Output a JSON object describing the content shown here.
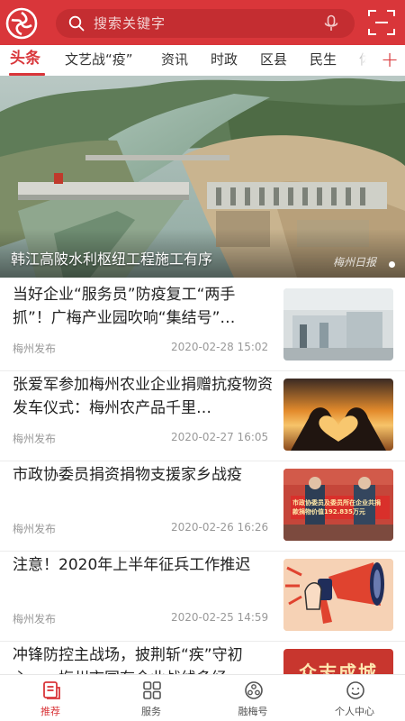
{
  "header": {
    "logo": "meizhou-logo",
    "search_placeholder": "搜索关键字",
    "search_icon": "search-icon",
    "mic_icon": "microphone-icon",
    "scan_icon": "scan-icon",
    "brand_color": "#d9363a"
  },
  "tabs": [
    {
      "label": "头条",
      "active": true
    },
    {
      "label": "文艺战“疫”",
      "active": false
    },
    {
      "label": "资讯",
      "active": false
    },
    {
      "label": "时政",
      "active": false
    },
    {
      "label": "区县",
      "active": false
    },
    {
      "label": "民生",
      "active": false
    },
    {
      "label": "体",
      "active": false
    }
  ],
  "tab_add_label": "+",
  "banner": {
    "title": "韩江高陂水利枢纽工程施工有序",
    "watermark": "梅州日报"
  },
  "news": [
    {
      "title": "当好企业“服务员”防疫复工“两手抓”！广梅产业园吹响“集结号”…",
      "source": "梅州发布",
      "time": "2020-02-28 15:02"
    },
    {
      "title": "张爱军参加梅州农业企业捐赠抗疫物资发车仪式：梅州农产品千里…",
      "source": "梅州发布",
      "time": "2020-02-27 16:05"
    },
    {
      "title": "市政协委员捐资捐物支援家乡战疫",
      "source": "梅州发布",
      "time": "2020-02-26 16:26",
      "banner_text": "市政协委员及委员所在企业共捐款捐物价值192.835万元"
    },
    {
      "title": "注意！2020年上半年征兵工作推迟",
      "source": "梅州发布",
      "time": "2020-02-25 14:59"
    },
    {
      "title": "冲锋防控主战场，披荆斩“疾”守初心……梅州市国有企业战线多经…",
      "source": "",
      "time": "",
      "thumb_text": "众志成城"
    }
  ],
  "bottom_nav": [
    {
      "label": "推荐",
      "icon": "recommend-icon",
      "active": true
    },
    {
      "label": "服务",
      "icon": "services-grid-icon",
      "active": false
    },
    {
      "label": "融梅号",
      "icon": "media-account-icon",
      "active": false
    },
    {
      "label": "个人中心",
      "icon": "profile-icon",
      "active": false
    }
  ]
}
